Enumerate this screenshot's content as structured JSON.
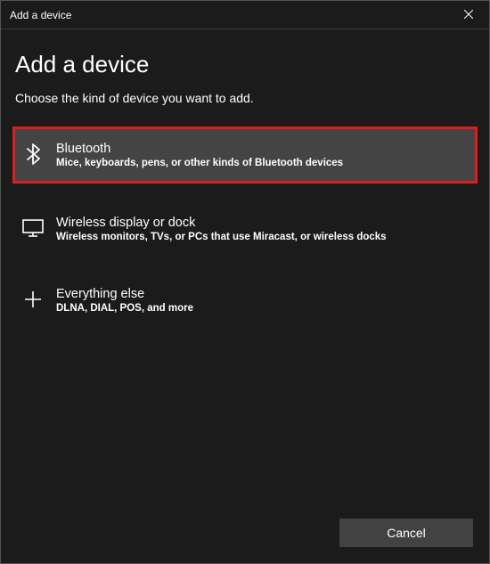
{
  "titlebar": {
    "title": "Add a device"
  },
  "heading": "Add a device",
  "subheading": "Choose the kind of device you want to add.",
  "options": [
    {
      "title": "Bluetooth",
      "desc": "Mice, keyboards, pens, or other kinds of Bluetooth devices"
    },
    {
      "title": "Wireless display or dock",
      "desc": "Wireless monitors, TVs, or PCs that use Miracast, or wireless docks"
    },
    {
      "title": "Everything else",
      "desc": "DLNA, DIAL, POS, and more"
    }
  ],
  "footer": {
    "cancel": "Cancel"
  }
}
